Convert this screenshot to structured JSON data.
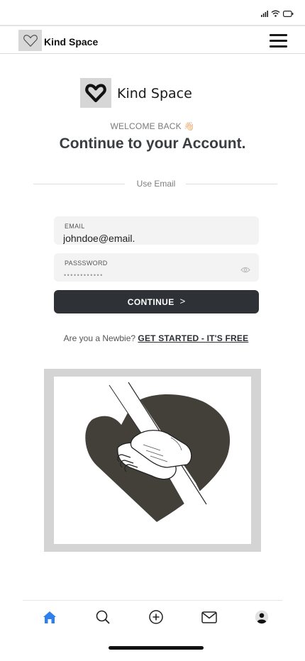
{
  "app": {
    "name": "Kind Space"
  },
  "header": {
    "title": "Kind Space",
    "menu_icon": "hamburger-menu-icon"
  },
  "brand": {
    "name": "Kind Space",
    "logo_icon": "heart-icon"
  },
  "login": {
    "welcome": "WELCOME BACK 👋🏻",
    "heading": "Continue to your Account.",
    "divider_label": "Use Email",
    "email": {
      "label": "EMAIL",
      "value": "johndoe@email."
    },
    "password": {
      "label": "PASSSWORD",
      "masked_value": "••••••••••••",
      "toggle_icon": "eye-icon"
    },
    "continue_label": "CONTINUE",
    "continue_arrow": ">",
    "signup_prompt": "Are you a Newbie?",
    "signup_link": "GET STARTED - IT'S FREE"
  },
  "illustration": {
    "icon": "heart-handshake-illustration"
  },
  "bottom_nav": {
    "active": "home",
    "items": [
      {
        "id": "home",
        "icon": "home-icon"
      },
      {
        "id": "search",
        "icon": "search-icon"
      },
      {
        "id": "add",
        "icon": "plus-circle-icon"
      },
      {
        "id": "messages",
        "icon": "mail-icon"
      },
      {
        "id": "profile",
        "icon": "user-icon"
      }
    ]
  },
  "colors": {
    "accent": "#2f80ed",
    "button": "#2e3236",
    "heart": "#43403a",
    "field_bg": "#f3f3f3"
  }
}
